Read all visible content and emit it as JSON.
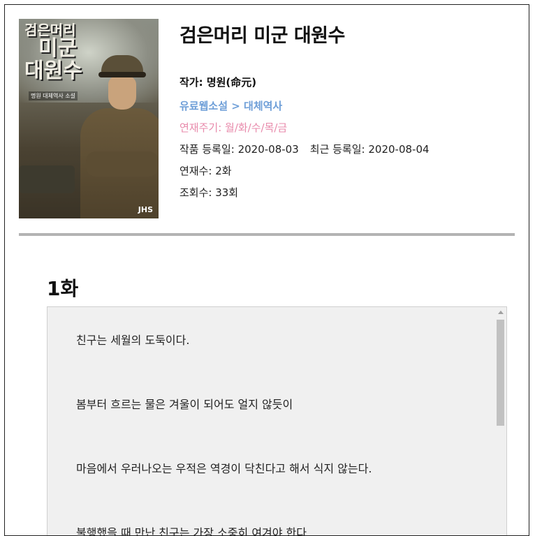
{
  "book": {
    "title": "검은머리 미군 대원수",
    "author": "작가: 명원(命元)",
    "genre": "유료웹소설 > 대체역사",
    "schedule": "연재주기: 월/화/수/목/금",
    "registered": "작품 등록일: 2020-08-03",
    "updated": "최근 등록일: 2020-08-04",
    "episodes": "연재수: 2화",
    "views": "조회수: 33회"
  },
  "cover": {
    "title_line1": "검은머리",
    "title_line2": "미군",
    "title_line3": "대원수",
    "credit": "명원 대체역사 소설",
    "badge": "JHS"
  },
  "chapter": {
    "heading": "1화",
    "lines": [
      "친구는 세월의 도둑이다.",
      "봄부터 흐르는 물은 겨울이 되어도 얼지 않듯이",
      "마음에서 우러나오는 우적은 역경이 닥친다고 해서 식지 않는다.",
      "불행했을 때 만난 친구는 가장 소중히 여겨야 한다."
    ]
  }
}
